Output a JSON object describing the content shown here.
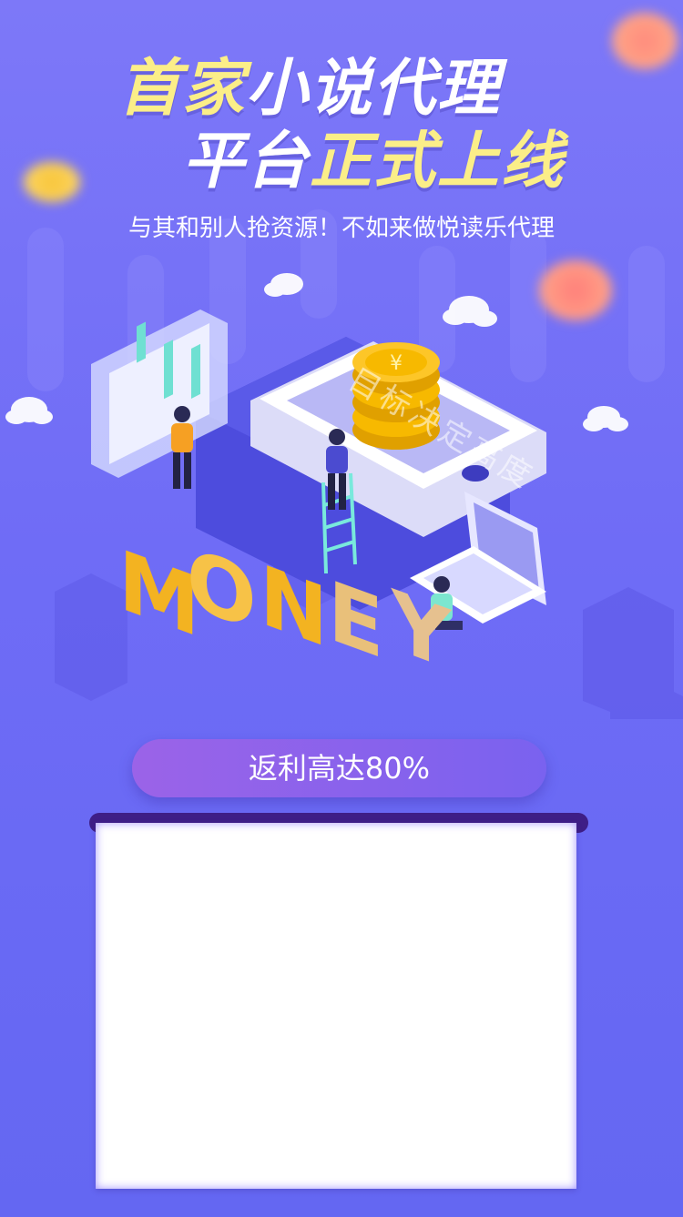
{
  "headline": {
    "line1_highlight": "首家",
    "line1_rest": "小说代理",
    "line2_rest": "平台",
    "line2_highlight": "正式上线"
  },
  "subtitle": "与其和别人抢资源！不如来做悦读乐代理",
  "illustration": {
    "watermark": "目标决定高度",
    "letters": [
      "M",
      "O",
      "N",
      "E",
      "Y"
    ],
    "coin_symbol": "¥"
  },
  "rebate_button": {
    "label": "返利高达80%"
  },
  "colors": {
    "background": "#7a76f7",
    "highlight": "#fbee88",
    "button": "#8a62ec",
    "scroll_bar": "#3e1e86"
  }
}
